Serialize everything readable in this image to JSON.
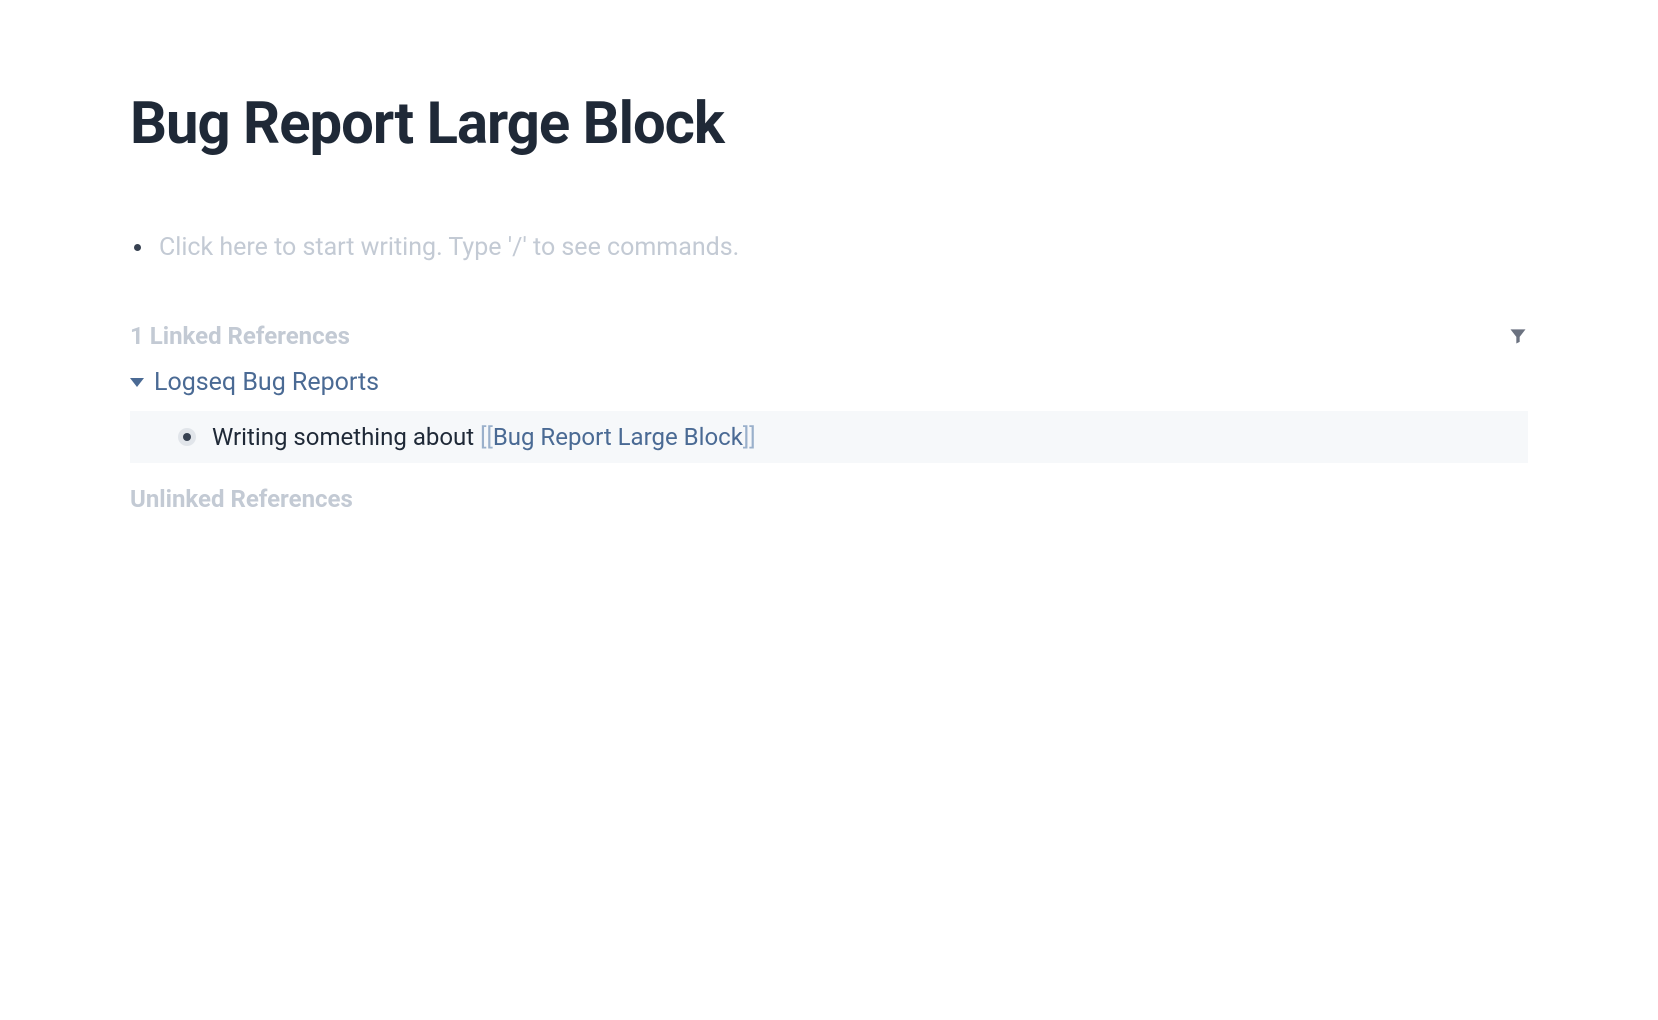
{
  "page": {
    "title": "Bug Report Large Block"
  },
  "editor": {
    "placeholder": "Click here to start writing. Type '/' to see commands."
  },
  "linked_references": {
    "title": "1 Linked References",
    "pages": [
      {
        "name": "Logseq Bug Reports",
        "blocks": [
          {
            "text_before": "Writing something about ",
            "link_text": "Bug Report Large Block"
          }
        ]
      }
    ]
  },
  "unlinked_references": {
    "title": "Unlinked References"
  }
}
